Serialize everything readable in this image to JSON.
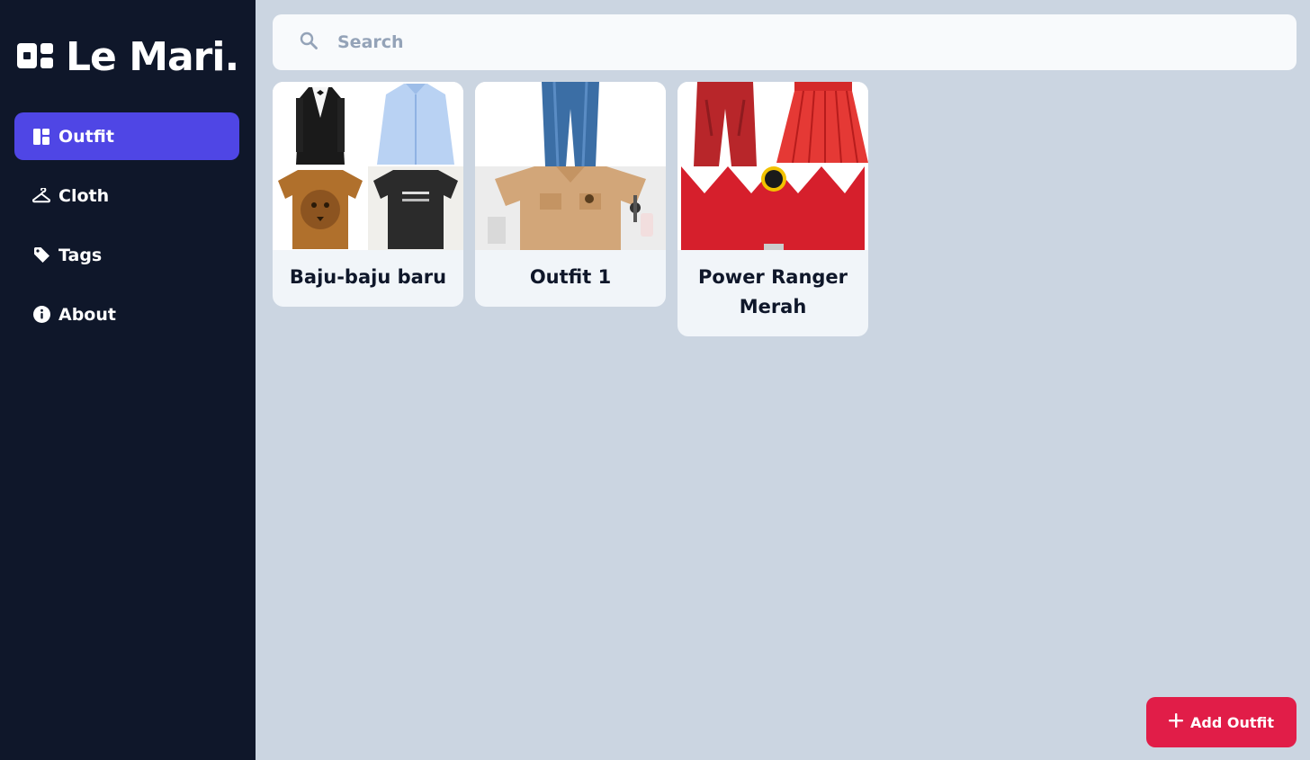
{
  "app": {
    "name": "Le Mari."
  },
  "sidebar": {
    "items": [
      {
        "label": "Outfit",
        "icon": "dashboard-icon",
        "active": true
      },
      {
        "label": "Cloth",
        "icon": "hanger-icon",
        "active": false
      },
      {
        "label": "Tags",
        "icon": "tag-icon",
        "active": false
      },
      {
        "label": "About",
        "icon": "info-icon",
        "active": false
      }
    ]
  },
  "search": {
    "placeholder": "Search",
    "value": ""
  },
  "outfits": [
    {
      "title": "Baju-baju baru",
      "items": [
        "black tuxedo",
        "light blue shirt",
        "lion print t-shirt",
        "black t-shirt"
      ]
    },
    {
      "title": "Outfit 1",
      "items": [
        "blue jeans",
        "khaki shirt with accessories"
      ]
    },
    {
      "title": "Power Ranger Merah",
      "items": [
        "red pants",
        "red pleated skirt",
        "red ranger shirt"
      ]
    }
  ],
  "actions": {
    "add_label": "Add Outfit"
  },
  "colors": {
    "sidebar_bg": "#0f172a",
    "accent": "#4f46e5",
    "add_button": "#e11d48",
    "page_bg": "#cbd5e1"
  }
}
